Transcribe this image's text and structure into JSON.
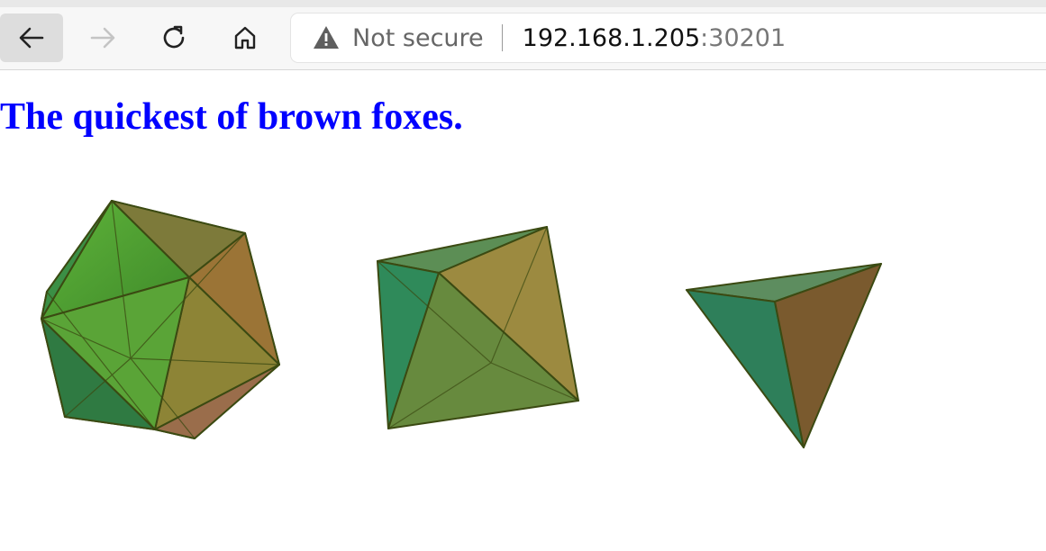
{
  "browser": {
    "security_status": "Not secure",
    "url_host": "192.168.1.205",
    "url_port": ":30201",
    "nav": {
      "back": "back-arrow-icon",
      "forward": "forward-arrow-icon",
      "refresh": "refresh-icon",
      "home": "home-icon"
    }
  },
  "page": {
    "heading": "The quickest of brown foxes.",
    "heading_color": "#0000ff",
    "shapes": [
      "icosahedron",
      "octahedron",
      "tetrahedron"
    ]
  }
}
